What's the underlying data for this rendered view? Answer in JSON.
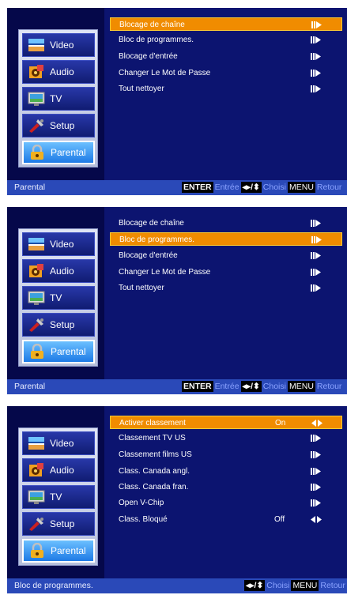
{
  "sidebar": {
    "items": [
      "Video",
      "Audio",
      "TV",
      "Setup",
      "Parental"
    ],
    "active": "Parental"
  },
  "screens": [
    {
      "menu": [
        {
          "label": "Blocage de chaîne",
          "value": "",
          "arrow": "right",
          "selected": true
        },
        {
          "label": "Bloc de programmes.",
          "value": "",
          "arrow": "right",
          "selected": false
        },
        {
          "label": "Blocage d'entrée",
          "value": "",
          "arrow": "right",
          "selected": false
        },
        {
          "label": "Changer Le Mot de Passe",
          "value": "",
          "arrow": "right",
          "selected": false
        },
        {
          "label": "Tout nettoyer",
          "value": "",
          "arrow": "right",
          "selected": false
        }
      ],
      "status": {
        "title": "Parental",
        "enter_key": "ENTER",
        "enter_text": "Entrée",
        "choose_text": "Choisi",
        "menu_key": "MENU",
        "menu_text": "Retour"
      }
    },
    {
      "menu": [
        {
          "label": "Blocage de chaîne",
          "value": "",
          "arrow": "right",
          "selected": false
        },
        {
          "label": "Bloc de programmes.",
          "value": "",
          "arrow": "right",
          "selected": true
        },
        {
          "label": "Blocage d'entrée",
          "value": "",
          "arrow": "right",
          "selected": false
        },
        {
          "label": "Changer Le Mot de Passe",
          "value": "",
          "arrow": "right",
          "selected": false
        },
        {
          "label": "Tout nettoyer",
          "value": "",
          "arrow": "right",
          "selected": false
        }
      ],
      "status": {
        "title": "Parental",
        "enter_key": "ENTER",
        "enter_text": "Entrée",
        "choose_text": "Choisi",
        "menu_key": "MENU",
        "menu_text": "Retour"
      }
    },
    {
      "menu": [
        {
          "label": "Activer classement",
          "value": "On",
          "arrow": "leftright",
          "selected": true
        },
        {
          "label": "Classement TV US",
          "value": "",
          "arrow": "right",
          "selected": false
        },
        {
          "label": "Classement films US",
          "value": "",
          "arrow": "right",
          "selected": false
        },
        {
          "label": "Class. Canada angl.",
          "value": "",
          "arrow": "right",
          "selected": false
        },
        {
          "label": "Class. Canada fran.",
          "value": "",
          "arrow": "right",
          "selected": false
        },
        {
          "label": "Open V-Chip",
          "value": "",
          "arrow": "right",
          "selected": false
        },
        {
          "label": "Class. Bloqué",
          "value": "Off",
          "arrow": "leftright",
          "selected": false
        }
      ],
      "status": {
        "title": "Bloc de programmes.",
        "enter_key": "",
        "enter_text": "",
        "choose_text": "Choisi",
        "menu_key": "MENU",
        "menu_text": "Retour"
      }
    }
  ],
  "colors": {
    "screen_bg": "#0c1470",
    "highlight": "#f08c00",
    "status_bar": "#2a49b8",
    "active_tab": "#1d7ae6"
  },
  "icons": [
    "video-icon",
    "audio-icon",
    "tv-icon",
    "setup-icon",
    "parental-lock-icon",
    "arrow-right-icon",
    "arrow-leftright-icon",
    "nav-arrows-icon"
  ]
}
